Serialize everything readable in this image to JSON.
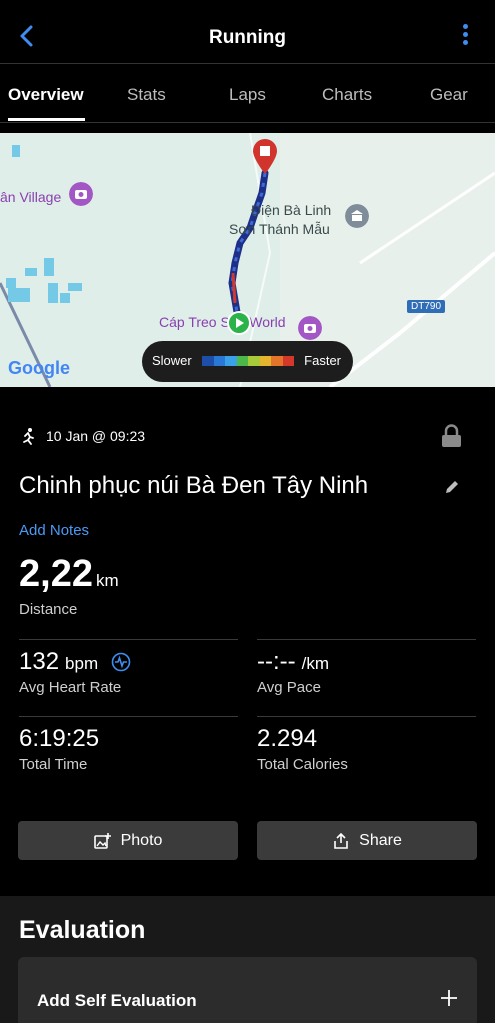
{
  "header": {
    "title": "Running"
  },
  "tabs": [
    {
      "label": "Overview",
      "active": true
    },
    {
      "label": "Stats"
    },
    {
      "label": "Laps"
    },
    {
      "label": "Charts"
    },
    {
      "label": "Gear"
    }
  ],
  "map": {
    "labels": {
      "village": "ân Village",
      "temple_line1": "Điện Bà Linh",
      "temple_line2": "Sơn Thánh Mẫu",
      "cable_car": "Cáp Treo Sun World",
      "road": "DT790"
    },
    "attribution": "Google",
    "legend": {
      "slow": "Slower",
      "fast": "Faster",
      "colors": [
        "#1e4fa8",
        "#2a78d6",
        "#3aa0e8",
        "#4cb84a",
        "#a8c93a",
        "#e6b52e",
        "#e4742a",
        "#d4382a"
      ]
    }
  },
  "activity": {
    "type_icon": "running-icon",
    "datetime": "10 Jan @ 09:23",
    "name": "Chinh phục núi Bà Đen Tây Ninh",
    "add_notes": "Add Notes"
  },
  "stats": {
    "distance": {
      "value": "2,22",
      "unit": "km",
      "label": "Distance"
    },
    "heart_rate": {
      "value": "132",
      "unit": "bpm",
      "label": "Avg Heart Rate"
    },
    "pace": {
      "value": "--:--",
      "unit": "/km",
      "label": "Avg Pace"
    },
    "time": {
      "value": "6:19:25",
      "label": "Total Time"
    },
    "calories": {
      "value": "2.294",
      "label": "Total Calories"
    }
  },
  "buttons": {
    "photo": "Photo",
    "share": "Share"
  },
  "evaluation": {
    "title": "Evaluation",
    "add_label": "Add Self Evaluation"
  },
  "colors": {
    "accent": "#3d8ef0",
    "link": "#4a9af5",
    "background": "#000000"
  }
}
